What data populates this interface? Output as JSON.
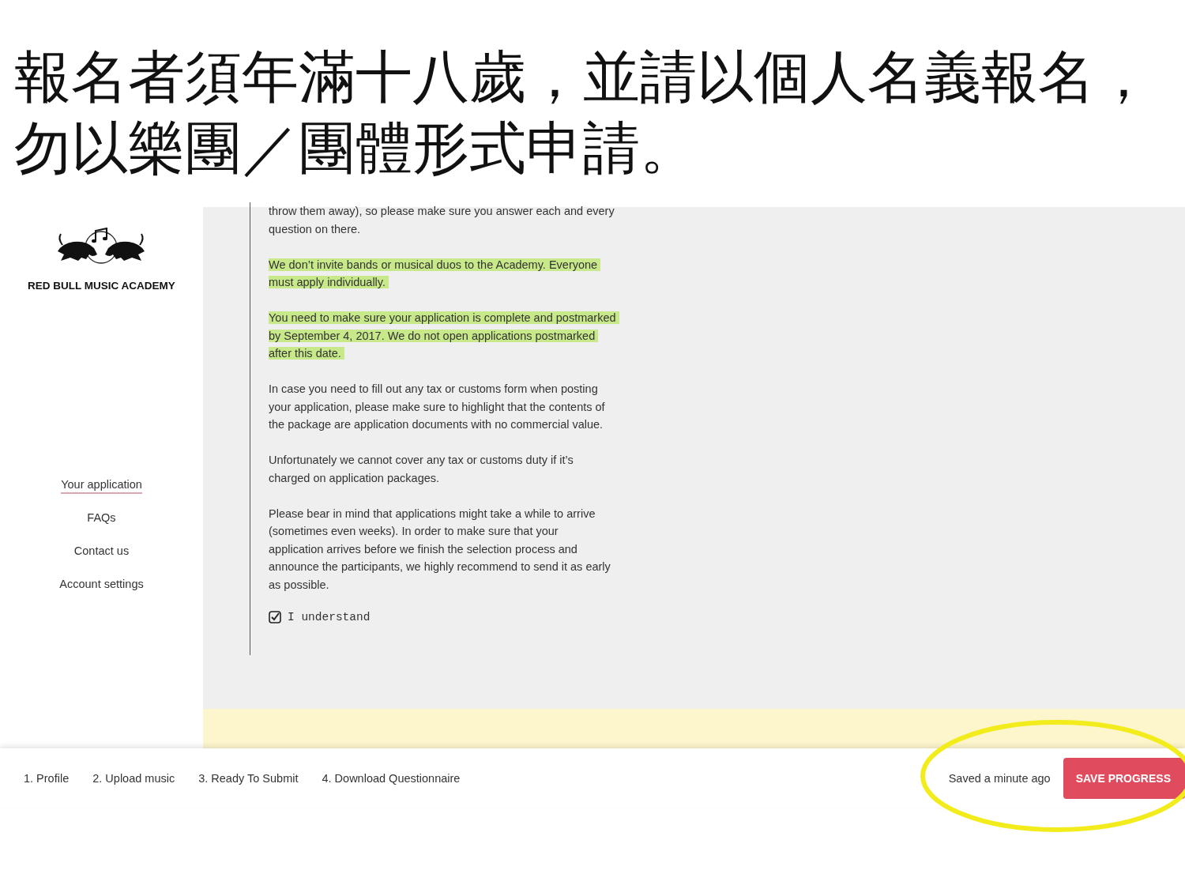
{
  "slide_title": "報名者須年滿十八歲，並請以個人名義報名，勿以樂團／團體形式申請。",
  "sidebar": {
    "logo_text": "RED BULL MUSIC ACADEMY",
    "nav": [
      {
        "label": "Your application",
        "selected": true
      },
      {
        "label": "FAQs",
        "selected": false
      },
      {
        "label": "Contact us",
        "selected": false
      },
      {
        "label": "Account settings",
        "selected": false
      }
    ]
  },
  "content": {
    "paragraphs": [
      {
        "text": "throw them away), so please make sure you answer each and every question on there.",
        "highlighted": false
      },
      {
        "text": "We don’t invite bands or musical duos to the Academy. Everyone must apply individually.",
        "highlighted": true
      },
      {
        "text": "You need to make sure your application is complete and postmarked by September 4, 2017. We do not open applications postmarked after this date.",
        "highlighted": true
      },
      {
        "text": "In case you need to fill out any tax or customs form when posting your application, please make sure to highlight that the contents of the package are application documents with no commercial value.",
        "highlighted": false
      },
      {
        "text": "Unfortunately we cannot cover any tax or customs duty if it’s charged on application packages.",
        "highlighted": false
      },
      {
        "text": "Please bear in mind that applications might take a while to arrive (sometimes even weeks). In order to make sure that your application arrives before we finish the selection process and announce the participants, we highly recommend to send it as early as possible.",
        "highlighted": false
      }
    ],
    "checkbox": {
      "label": "I understand",
      "checked": true
    }
  },
  "footer": {
    "steps": [
      "1. Profile",
      "2. Upload music",
      "3. Ready To Submit",
      "4. Download Questionnaire"
    ],
    "save_status": "Saved a minute ago",
    "save_button": "SAVE PROGRESS"
  }
}
